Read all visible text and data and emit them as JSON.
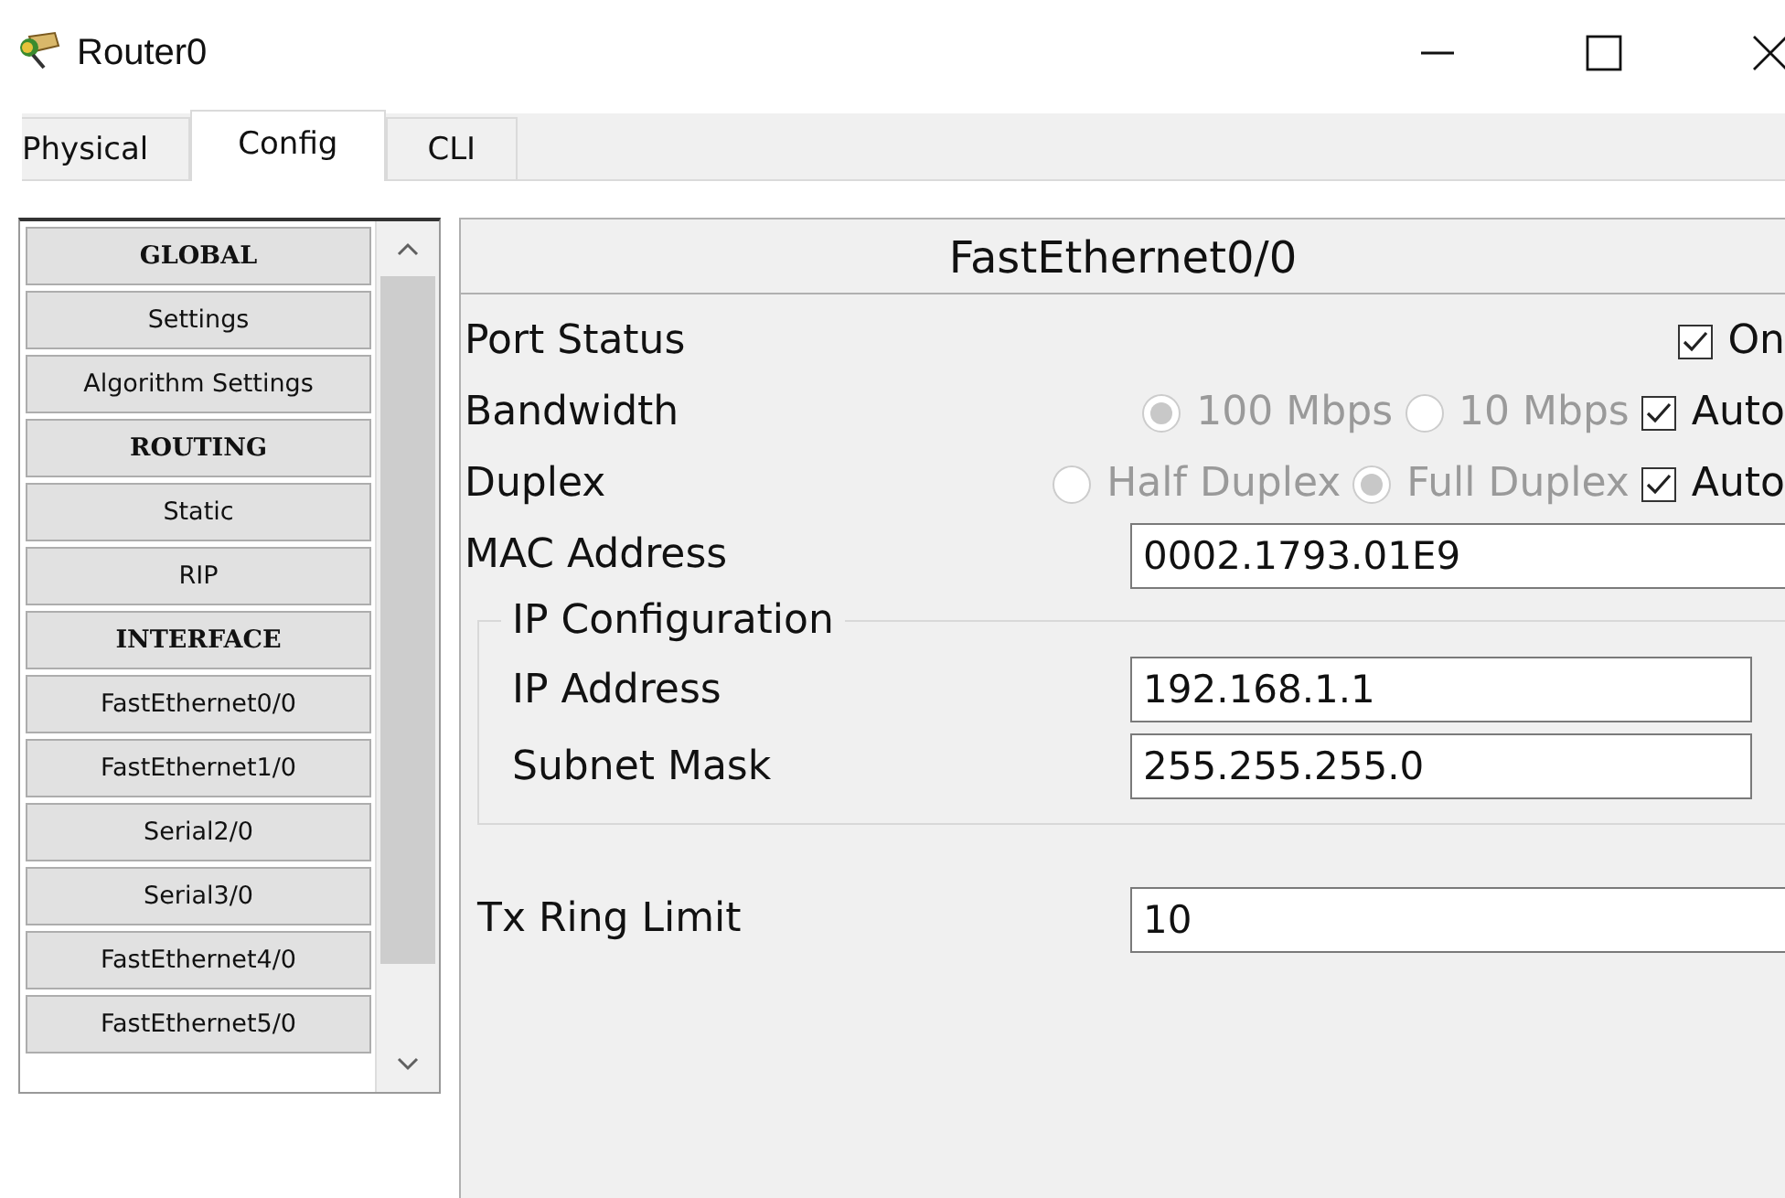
{
  "window": {
    "title": "Router0"
  },
  "tabs": [
    {
      "label": "Physical",
      "selected": false
    },
    {
      "label": "Config",
      "selected": true
    },
    {
      "label": "CLI",
      "selected": false
    }
  ],
  "sidebar": {
    "items": [
      {
        "label": "GLOBAL",
        "kind": "header"
      },
      {
        "label": "Settings",
        "kind": "item"
      },
      {
        "label": "Algorithm Settings",
        "kind": "item"
      },
      {
        "label": "ROUTING",
        "kind": "header"
      },
      {
        "label": "Static",
        "kind": "item"
      },
      {
        "label": "RIP",
        "kind": "item"
      },
      {
        "label": "INTERFACE",
        "kind": "header"
      },
      {
        "label": "FastEthernet0/0",
        "kind": "item"
      },
      {
        "label": "FastEthernet1/0",
        "kind": "item"
      },
      {
        "label": "Serial2/0",
        "kind": "item"
      },
      {
        "label": "Serial3/0",
        "kind": "item"
      },
      {
        "label": "FastEthernet4/0",
        "kind": "item"
      },
      {
        "label": "FastEthernet5/0",
        "kind": "item"
      }
    ]
  },
  "panel": {
    "title": "FastEthernet0/0",
    "port_status": {
      "label": "Port Status",
      "toggle": {
        "label": "On",
        "checked": true
      }
    },
    "bandwidth": {
      "label": "Bandwidth",
      "disabled": true,
      "options": [
        {
          "label": "100 Mbps",
          "selected": true
        },
        {
          "label": "10 Mbps",
          "selected": false
        }
      ],
      "auto": {
        "label": "Auto",
        "checked": true
      }
    },
    "duplex": {
      "label": "Duplex",
      "disabled": true,
      "options": [
        {
          "label": "Half Duplex",
          "selected": false
        },
        {
          "label": "Full Duplex",
          "selected": true
        }
      ],
      "auto": {
        "label": "Auto",
        "checked": true
      }
    },
    "mac_address": {
      "label": "MAC Address",
      "value": "0002.1793.01E9"
    },
    "ip_configuration": {
      "title": "IP Configuration",
      "fields": [
        {
          "label": "IP Address",
          "value": "192.168.1.1"
        },
        {
          "label": "Subnet Mask",
          "value": "255.255.255.0"
        }
      ]
    },
    "tx_ring_limit": {
      "label": "Tx Ring Limit",
      "value": "10"
    }
  }
}
